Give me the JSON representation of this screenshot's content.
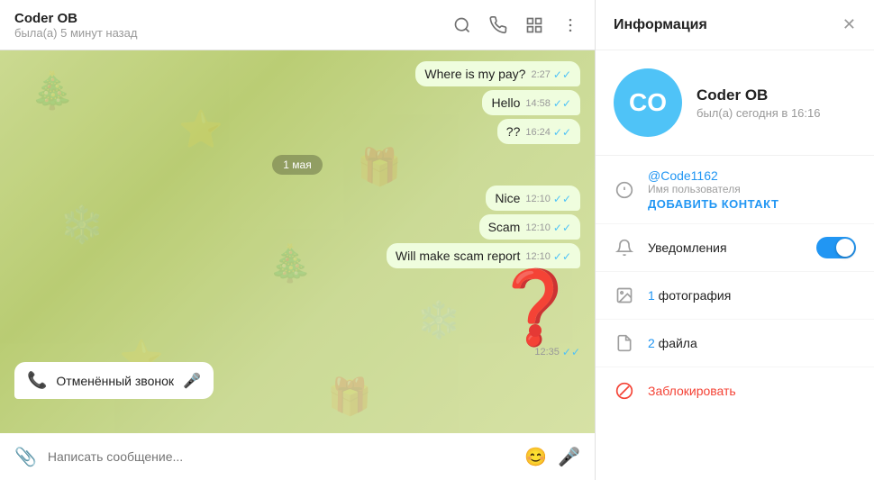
{
  "header": {
    "name": "Coder OB",
    "status": "была(а) 5 минут назад",
    "icons": [
      "search",
      "phone",
      "layout",
      "more"
    ]
  },
  "messages": [
    {
      "id": 1,
      "text": "Where is my pay?",
      "time": "2:27",
      "type": "outgoing",
      "read": true
    },
    {
      "id": 2,
      "text": "Hello",
      "time": "14:58",
      "type": "outgoing",
      "read": true
    },
    {
      "id": 3,
      "text": "??",
      "time": "16:24",
      "type": "outgoing",
      "read": true
    },
    {
      "id": 4,
      "date_divider": "1 мая"
    },
    {
      "id": 5,
      "text": "Nice",
      "time": "12:10",
      "type": "outgoing",
      "read": true
    },
    {
      "id": 6,
      "text": "Scam",
      "time": "12:10",
      "type": "outgoing",
      "read": true
    },
    {
      "id": 7,
      "text": "Will make scam report",
      "time": "12:10",
      "type": "outgoing",
      "read": true
    },
    {
      "id": 8,
      "type": "sticker",
      "time": "12:35",
      "read": true
    },
    {
      "id": 9,
      "type": "missed_call",
      "text": "Отменённый звонок"
    }
  ],
  "input": {
    "placeholder": "Написать сообщение..."
  },
  "info_panel": {
    "title": "Информация",
    "avatar_initials": "CO",
    "avatar_bg": "#4fc3f7",
    "contact_name": "Coder OB",
    "contact_status": "был(а) сегодня в 16:16",
    "username": "@Code1162",
    "username_label": "Имя пользователя",
    "add_contact": "ДОБАВИТЬ КОНТАКТ",
    "notifications_label": "Уведомления",
    "notifications_on": true,
    "photos_count": "1 фотография",
    "files_count": "2 файла",
    "block_label": "Заблокировать"
  }
}
